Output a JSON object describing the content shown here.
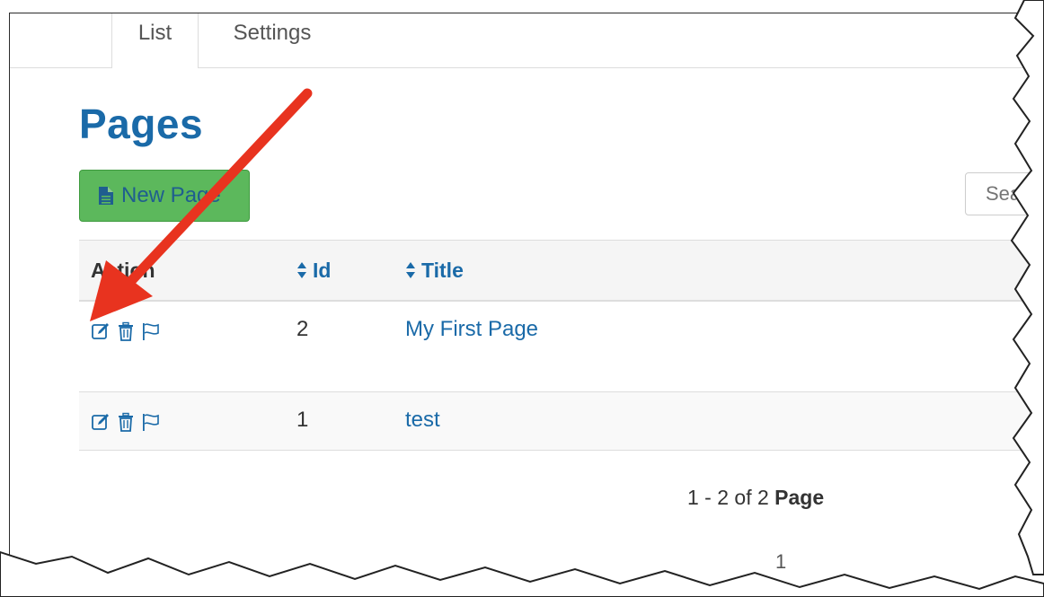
{
  "tabs": [
    {
      "label": "List",
      "active": true
    },
    {
      "label": "Settings",
      "active": false
    }
  ],
  "page": {
    "title": "Pages",
    "new_button_label": "New Page",
    "search_placeholder": "Search"
  },
  "table": {
    "headers": {
      "action": "Action",
      "id": "Id",
      "title": "Title"
    },
    "rows": [
      {
        "id": "2",
        "title": "My First Page"
      },
      {
        "id": "1",
        "title": "test"
      }
    ]
  },
  "pagination": {
    "summary": "1 - 2 of 2",
    "unit": "Page",
    "current_page": "1"
  },
  "icons": {
    "edit": "edit-icon",
    "delete": "trash-icon",
    "flag": "flag-icon",
    "sort": "sort-icon",
    "document": "document-icon"
  },
  "colors": {
    "link": "#1a6aa8",
    "success": "#5cb85c",
    "annotation_arrow": "#e8331f"
  }
}
